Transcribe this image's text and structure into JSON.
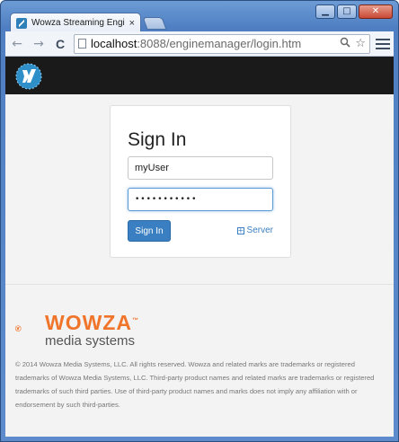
{
  "browser": {
    "tab_title": "Wowza Streaming Engine Ma",
    "tab_close": "×",
    "window_controls": {
      "minimize": "▁",
      "maximize": "□",
      "close": "✕"
    },
    "nav": {
      "back_icon": "arrow-left-icon",
      "forward_icon": "arrow-right-icon",
      "reload_icon": "reload-icon",
      "back_glyph": "←",
      "forward_glyph": "→",
      "reload_glyph": "C"
    },
    "address_bar": {
      "host": "localhost",
      "path": ":8088/enginemanager/login.htm",
      "search_glyph": "🔍",
      "bookmark_glyph": "☆"
    }
  },
  "login": {
    "title": "Sign In",
    "username_value": "myUser",
    "password_value": "•••••••••••",
    "signin_label": "Sign In",
    "server_link_label": "Server",
    "server_icon_glyph": "+"
  },
  "footer": {
    "brand": "WOWZA",
    "tm": "™",
    "subbrand": "media systems",
    "copyright": "© 2014 Wowza Media Systems, LLC. All rights reserved. Wowza and related marks are trademarks or registered trademarks of Wowza Media Systems, LLC. Third-party product names and related marks are trademarks or registered trademarks of such third parties. Use of third-party product names and marks does not imply any affiliation with or endorsement by such third-parties."
  },
  "colors": {
    "header_bg": "#1a1a1a",
    "accent_blue": "#3a7fc1",
    "brand_orange": "#f0742a",
    "page_bg": "#f3f3f3"
  }
}
